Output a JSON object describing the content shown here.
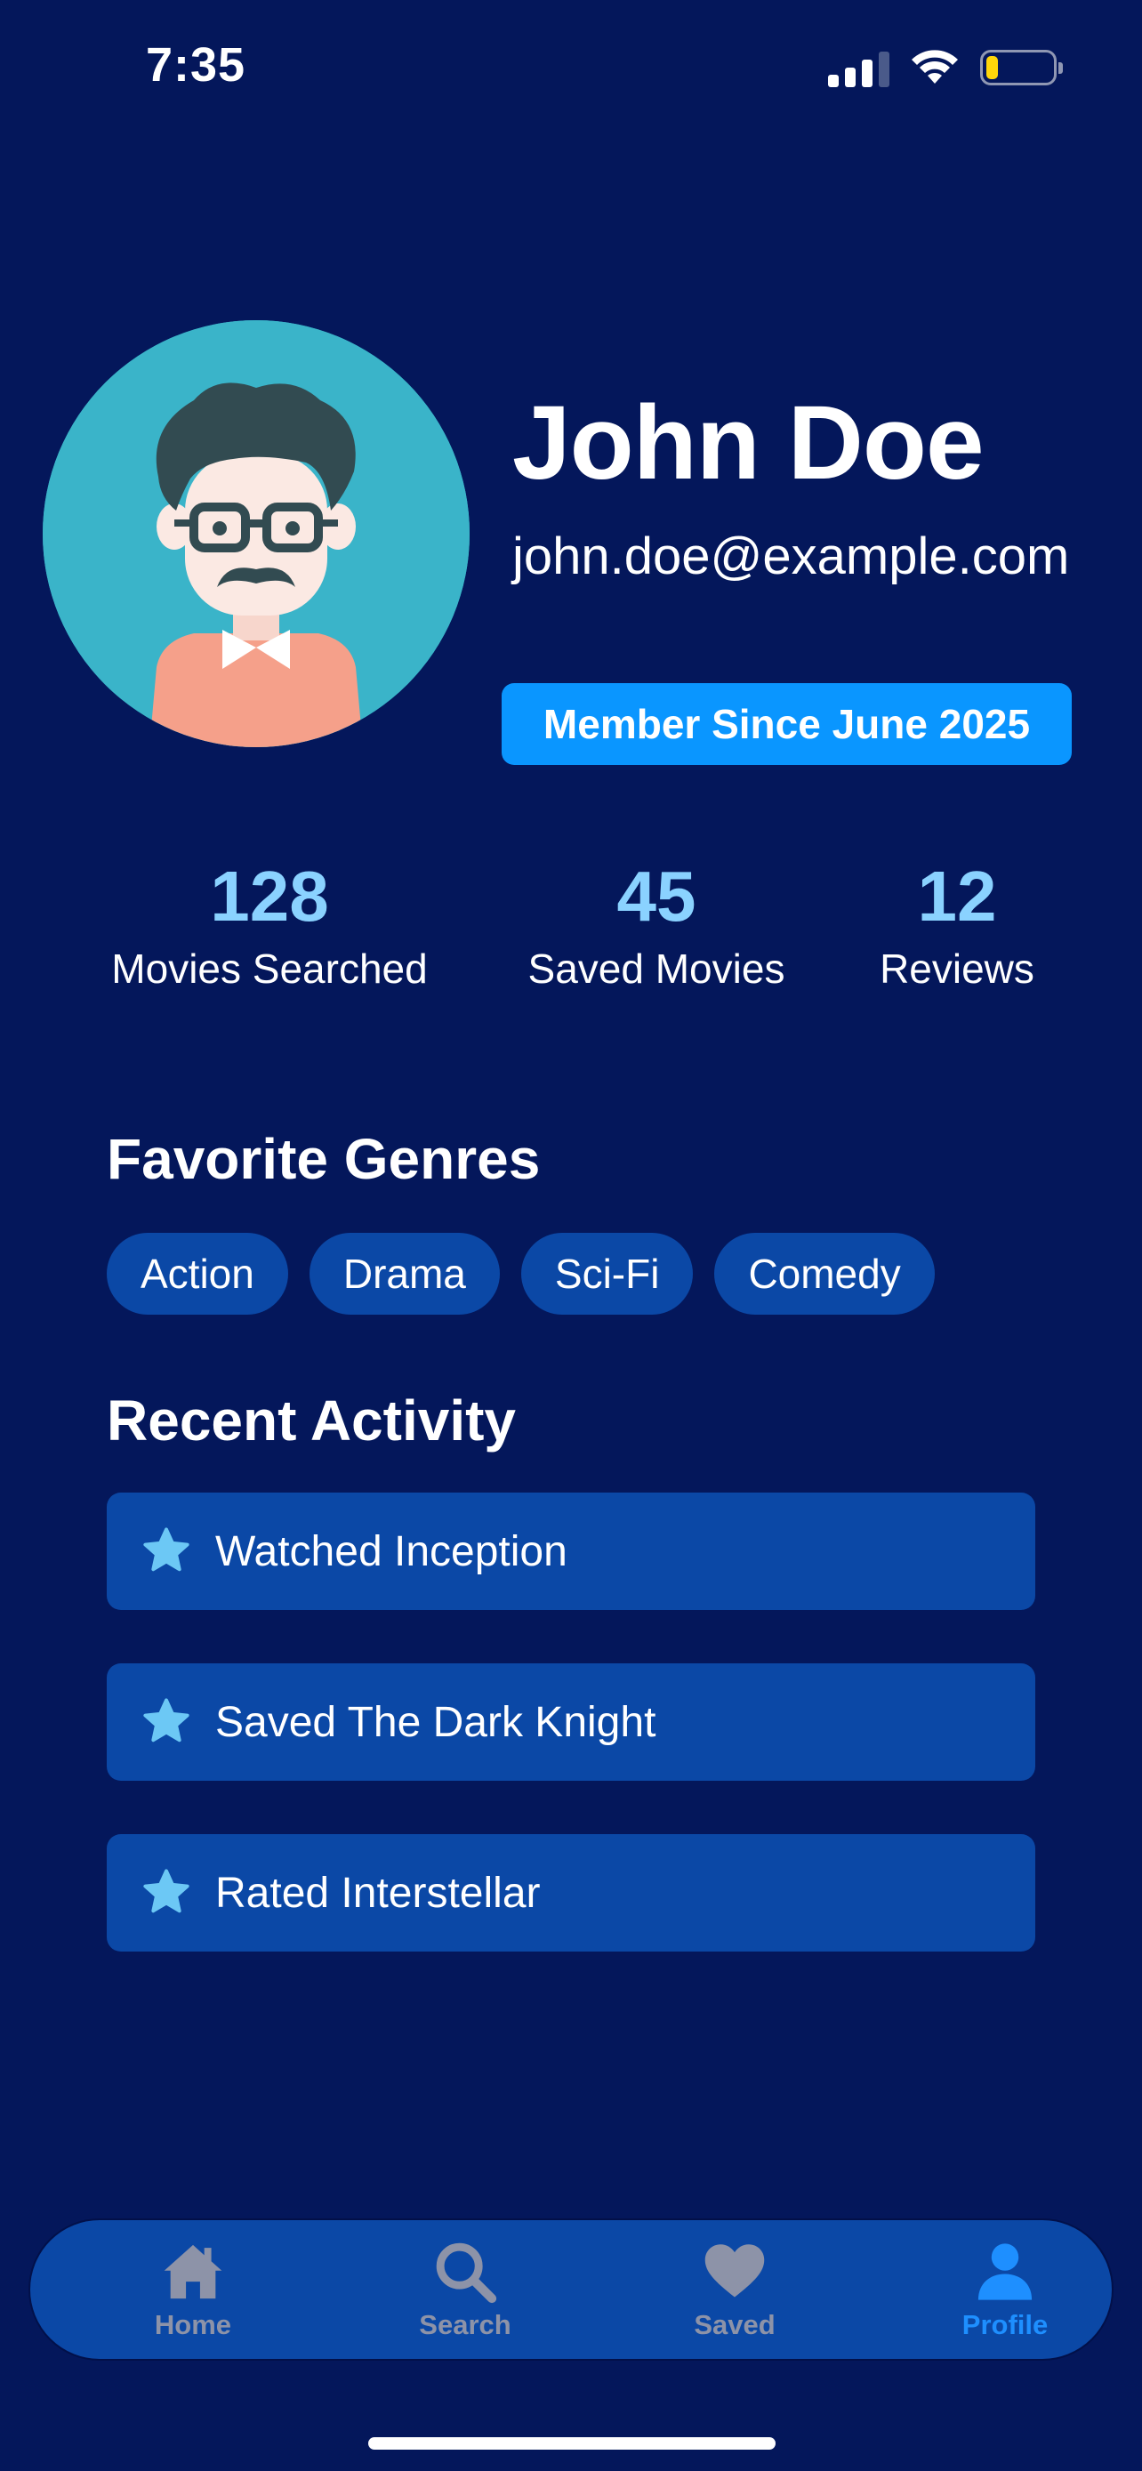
{
  "status_bar": {
    "time": "7:35"
  },
  "profile": {
    "name": "John Doe",
    "email": "john.doe@example.com",
    "member_badge": "Member Since June 2025"
  },
  "stats": [
    {
      "value": "128",
      "label": "Movies Searched"
    },
    {
      "value": "45",
      "label": "Saved Movies"
    },
    {
      "value": "12",
      "label": "Reviews"
    }
  ],
  "favorite_genres": {
    "title": "Favorite Genres",
    "items": [
      "Action",
      "Drama",
      "Sci-Fi",
      "Comedy"
    ]
  },
  "recent_activity": {
    "title": "Recent Activity",
    "items": [
      {
        "icon": "star-icon",
        "text": "Watched Inception"
      },
      {
        "icon": "star-icon",
        "text": "Saved The Dark Knight"
      },
      {
        "icon": "star-icon",
        "text": "Rated Interstellar"
      }
    ]
  },
  "tab_bar": {
    "active": "Profile",
    "tabs": [
      {
        "icon": "home-icon",
        "label": "Home"
      },
      {
        "icon": "search-icon",
        "label": "Search"
      },
      {
        "icon": "heart-icon",
        "label": "Saved"
      },
      {
        "icon": "person-icon",
        "label": "Profile"
      }
    ]
  },
  "colors": {
    "background": "#04175b",
    "card": "#0b48a6",
    "accent": "#0a96ff",
    "stat_value": "#8ad2ff",
    "active_tab": "#1e8fff",
    "inactive_tab": "#8d93a8"
  }
}
